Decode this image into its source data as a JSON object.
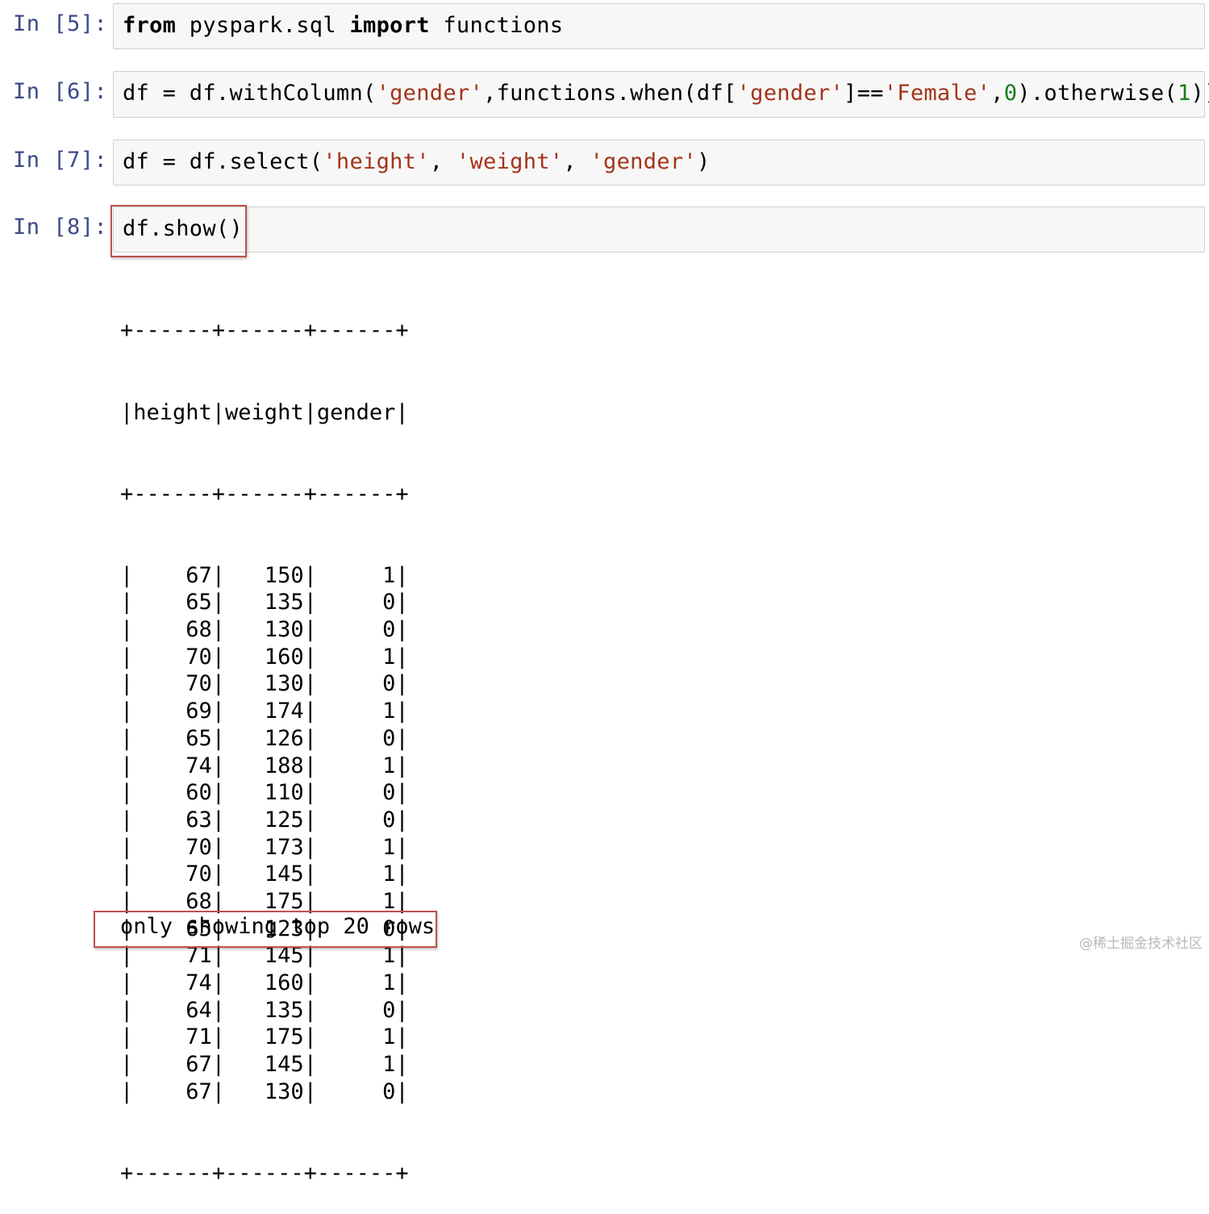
{
  "cells": [
    {
      "prompt": "In [5]:",
      "tokens": [
        {
          "t": "from",
          "c": "kw"
        },
        {
          "t": " pyspark.sql ",
          "c": ""
        },
        {
          "t": "import",
          "c": "kw"
        },
        {
          "t": " functions",
          "c": ""
        }
      ]
    },
    {
      "prompt": "In [6]:",
      "tokens": [
        {
          "t": "df = df.withColumn(",
          "c": ""
        },
        {
          "t": "'gender'",
          "c": "str"
        },
        {
          "t": ",functions.when(df[",
          "c": ""
        },
        {
          "t": "'gender'",
          "c": "str"
        },
        {
          "t": "]==",
          "c": ""
        },
        {
          "t": "'Female'",
          "c": "str"
        },
        {
          "t": ",",
          "c": ""
        },
        {
          "t": "0",
          "c": "num"
        },
        {
          "t": ").otherwise(",
          "c": ""
        },
        {
          "t": "1",
          "c": "num"
        },
        {
          "t": "))",
          "c": ""
        }
      ]
    },
    {
      "prompt": "In [7]:",
      "tokens": [
        {
          "t": "df = df.select(",
          "c": ""
        },
        {
          "t": "'height'",
          "c": "str"
        },
        {
          "t": ", ",
          "c": ""
        },
        {
          "t": "'weight'",
          "c": "str"
        },
        {
          "t": ", ",
          "c": ""
        },
        {
          "t": "'gender'",
          "c": "str"
        },
        {
          "t": ")",
          "c": ""
        }
      ]
    },
    {
      "prompt": "In [8]:",
      "tokens": [
        {
          "t": "df.show()",
          "c": ""
        }
      ]
    }
  ],
  "output": {
    "border": "+------+------+------+",
    "header": "|height|weight|gender|",
    "columns": [
      "height",
      "weight",
      "gender"
    ],
    "rows": [
      [
        "67",
        "150",
        "1"
      ],
      [
        "65",
        "135",
        "0"
      ],
      [
        "68",
        "130",
        "0"
      ],
      [
        "70",
        "160",
        "1"
      ],
      [
        "70",
        "130",
        "0"
      ],
      [
        "69",
        "174",
        "1"
      ],
      [
        "65",
        "126",
        "0"
      ],
      [
        "74",
        "188",
        "1"
      ],
      [
        "60",
        "110",
        "0"
      ],
      [
        "63",
        "125",
        "0"
      ],
      [
        "70",
        "173",
        "1"
      ],
      [
        "70",
        "145",
        "1"
      ],
      [
        "68",
        "175",
        "1"
      ],
      [
        "65",
        "123",
        "0"
      ],
      [
        "71",
        "145",
        "1"
      ],
      [
        "74",
        "160",
        "1"
      ],
      [
        "64",
        "135",
        "0"
      ],
      [
        "71",
        "175",
        "1"
      ],
      [
        "67",
        "145",
        "1"
      ],
      [
        "67",
        "130",
        "0"
      ]
    ],
    "note": "only showing top 20 rows"
  },
  "watermark": "@稀土掘金技术社区",
  "colors": {
    "prompt": "#3b4a86",
    "string": "#a3341a",
    "number": "#1a7a1a",
    "highlight_box": "#c0504d",
    "input_bg": "#f7f7f7"
  }
}
